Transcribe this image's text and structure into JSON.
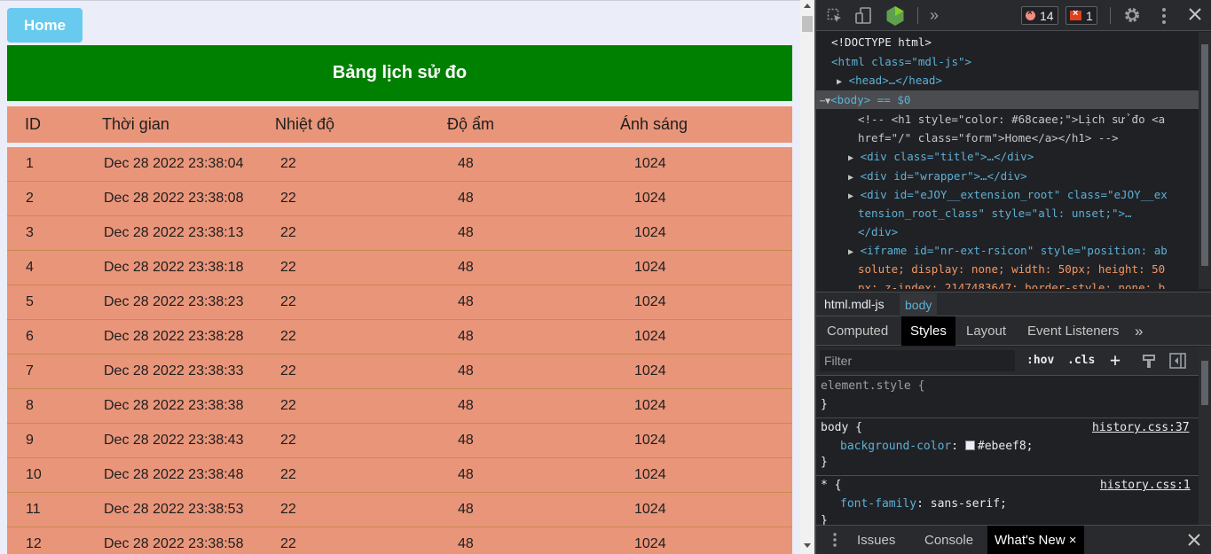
{
  "page": {
    "home_label": "Home",
    "title": "Bảng lịch sử đo",
    "headers": [
      "ID",
      "Thời gian",
      "Nhiệt độ",
      "Độ ẩm",
      "Ánh sáng"
    ],
    "rows": [
      {
        "id": "1",
        "time": "Dec 28 2022 23:38:04",
        "temp": "22",
        "hum": "48",
        "light": "1024"
      },
      {
        "id": "2",
        "time": "Dec 28 2022 23:38:08",
        "temp": "22",
        "hum": "48",
        "light": "1024"
      },
      {
        "id": "3",
        "time": "Dec 28 2022 23:38:13",
        "temp": "22",
        "hum": "48",
        "light": "1024"
      },
      {
        "id": "4",
        "time": "Dec 28 2022 23:38:18",
        "temp": "22",
        "hum": "48",
        "light": "1024"
      },
      {
        "id": "5",
        "time": "Dec 28 2022 23:38:23",
        "temp": "22",
        "hum": "48",
        "light": "1024"
      },
      {
        "id": "6",
        "time": "Dec 28 2022 23:38:28",
        "temp": "22",
        "hum": "48",
        "light": "1024"
      },
      {
        "id": "7",
        "time": "Dec 28 2022 23:38:33",
        "temp": "22",
        "hum": "48",
        "light": "1024"
      },
      {
        "id": "8",
        "time": "Dec 28 2022 23:38:38",
        "temp": "22",
        "hum": "48",
        "light": "1024"
      },
      {
        "id": "9",
        "time": "Dec 28 2022 23:38:43",
        "temp": "22",
        "hum": "48",
        "light": "1024"
      },
      {
        "id": "10",
        "time": "Dec 28 2022 23:38:48",
        "temp": "22",
        "hum": "48",
        "light": "1024"
      },
      {
        "id": "11",
        "time": "Dec 28 2022 23:38:53",
        "temp": "22",
        "hum": "48",
        "light": "1024"
      },
      {
        "id": "12",
        "time": "Dec 28 2022 23:38:58",
        "temp": "22",
        "hum": "48",
        "light": "1024"
      }
    ],
    "colors": {
      "home": "#68caee",
      "title_bg": "#008000",
      "row_bg": "#e9957a",
      "body_bg": "#ebeef8"
    }
  },
  "devtools": {
    "toolbar": {
      "icons": [
        "inspect-icon",
        "device-toggle-icon",
        "nodejs-icon",
        "more-tabs-icon",
        "settings-icon",
        "kebab-menu-icon",
        "close-icon"
      ],
      "errors_count": "14",
      "issues_count": "1",
      "more_tabs_glyph": "»"
    },
    "elements": {
      "doctype": "<!DOCTYPE html>",
      "html_open": "<html class=\"mdl-js\">",
      "head": "<head>…</head>",
      "body_selected": "<body> == $0",
      "comment_line1": "<!-- <h1 style=\"color: #68caee;\">Lịch sử đo <a",
      "comment_line2": "href=\"/\" class=\"form\">Home</a></h1> -->",
      "div_title": "<div class=\"title\">…</div>",
      "div_wrapper": "<div id=\"wrapper\">…</div>",
      "ejoy_line1": "<div id=\"eJOY__extension_root\" class=\"eJOY__ex",
      "ejoy_line2": "tension_root_class\" style=\"all: unset;\">…",
      "ejoy_line3": "</div>",
      "iframe_line1": "<iframe id=\"nr-ext-rsicon\" style=\"position: ab",
      "iframe_line2": "solute; display: none; width: 50px; height: 50",
      "iframe_line3": "px; z-index: 2147483647; border-style: none; b"
    },
    "breadcrumbs": [
      "html.mdl-js",
      "body"
    ],
    "tabs": [
      "Computed",
      "Styles",
      "Layout",
      "Event Listeners",
      "»"
    ],
    "active_tab": "Styles",
    "filter": {
      "placeholder": "Filter",
      "hov": ":hov",
      "cls": ".cls",
      "plus": "+"
    },
    "styles": {
      "element_style": "element.style {",
      "element_close": "}",
      "body_selector": "body {",
      "body_source": "history.css:37",
      "body_prop": "background-color",
      "body_value": "#ebeef8;",
      "body_close": "}",
      "star_selector": "* {",
      "star_source": "history.css:1",
      "star_prop": "font-family",
      "star_value": "sans-serif;",
      "star_close": "}"
    },
    "drawer": {
      "tabs": [
        "Issues",
        "Console",
        "What's New"
      ],
      "active": "What's New",
      "close_glyph": "×"
    }
  }
}
